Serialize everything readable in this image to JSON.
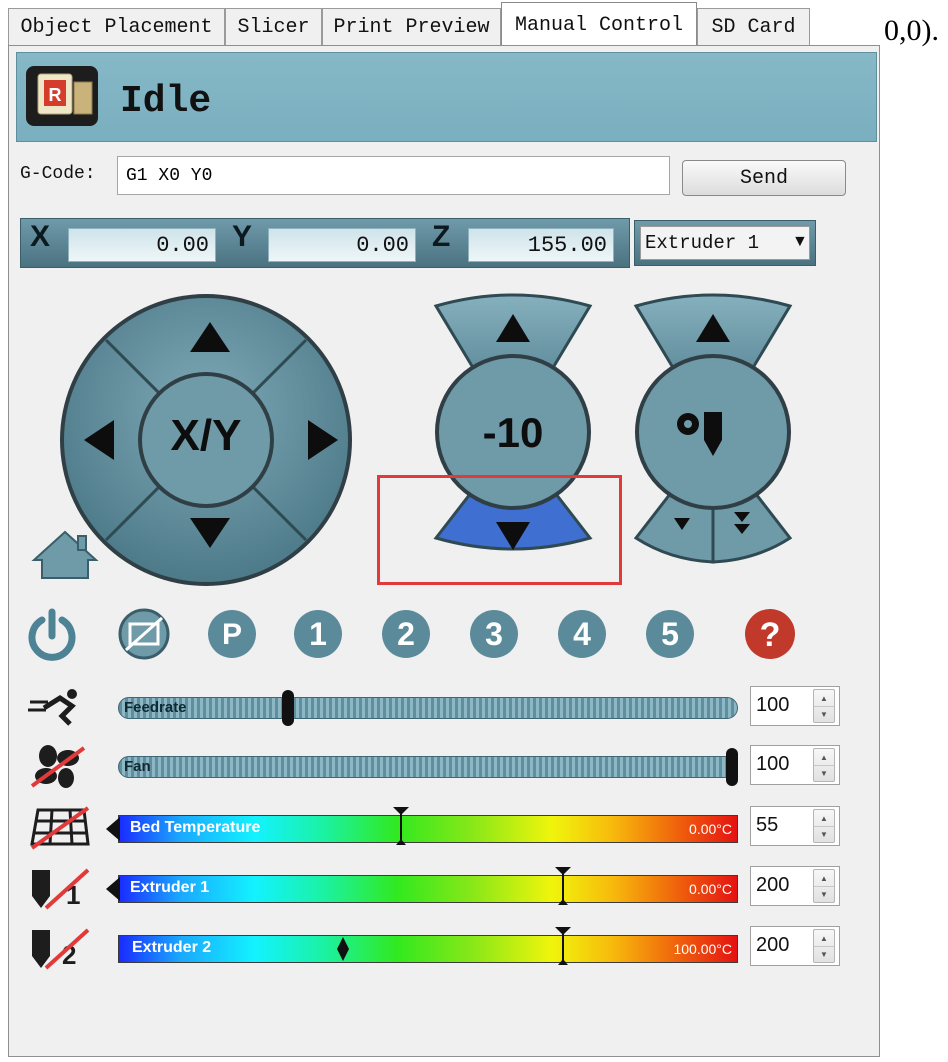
{
  "tabs": [
    {
      "label": "Object Placement",
      "active": false
    },
    {
      "label": "Slicer",
      "active": false
    },
    {
      "label": "Print Preview",
      "active": false
    },
    {
      "label": "Manual Control",
      "active": true
    },
    {
      "label": "SD Card",
      "active": false
    }
  ],
  "coords_note": "0,0).",
  "status": {
    "text": "Idle",
    "icon": "repetier-logo-icon"
  },
  "gcode": {
    "label": "G-Code:",
    "value": "G1 X0 Y0",
    "send_label": "Send"
  },
  "position": {
    "x_label": "X",
    "x_value": "0.00",
    "y_label": "Y",
    "y_value": "0.00",
    "z_label": "Z",
    "z_value": "155.00",
    "extruder_select": "Extruder 1"
  },
  "jog": {
    "xy_label": "X/Y",
    "z_label": "-10",
    "highlighted": "z-down-button"
  },
  "function_icons": [
    "power-icon",
    "motors-off-icon",
    "park-icon",
    "1",
    "2",
    "3",
    "4",
    "5",
    "help-icon"
  ],
  "sliders": {
    "feedrate": {
      "label": "Feedrate",
      "value": "100",
      "level": 0.27
    },
    "fan": {
      "label": "Fan",
      "value": "100",
      "level": 1.0
    }
  },
  "temperatures": {
    "bed": {
      "label": "Bed Temperature",
      "current": "0.00°C",
      "target": "55"
    },
    "extruder1": {
      "label": "Extruder 1",
      "current": "0.00°C",
      "target": "200"
    },
    "extruder2": {
      "label": "Extruder 2",
      "current": "100.00°C",
      "target": "200"
    }
  },
  "colors": {
    "accent": "#7aafbf",
    "button_teal": "#5b8b9b",
    "highlight_blue": "#3f6fd0",
    "help_red": "#c0392b",
    "annotation_red": "#e03a3a"
  }
}
